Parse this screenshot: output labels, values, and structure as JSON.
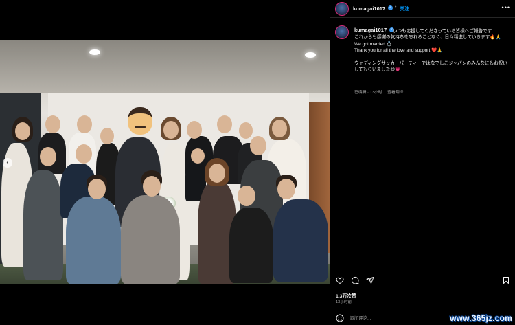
{
  "post": {
    "username": "kumagai1017",
    "follow_label": "关注",
    "separator": "•",
    "more_label": "•••",
    "caption": {
      "line1": "いつも応援してくださっている皆様へご報告です",
      "line2": "これからも感謝の気持ちを忘れることなく、日々精進していきます🔥🙏",
      "line3": "We got married 💍",
      "line4": "Thank you for all the love and support ❤️🙏",
      "line5": "ウェディングサッカーパーティーではなでしこジャパンのみんなにもお祝いしてもらいました😊💗"
    },
    "meta": {
      "edited": "已编辑 · 13小时",
      "translate": "查看翻译"
    },
    "likes": "1.3万次赞",
    "time_ago": "13小时前",
    "comment_placeholder": "添加评论...",
    "icons": [
      "heart-icon",
      "comment-icon",
      "share-icon",
      "bookmark-icon",
      "emoji-icon",
      "verified-icon",
      "chevron-left-icon"
    ]
  },
  "watermark": "www.365jz.com",
  "colors": {
    "accent": "#0095f6",
    "verified": "#3897f0",
    "panel_bg": "#000000",
    "muted_text": "#a8a8a8"
  }
}
